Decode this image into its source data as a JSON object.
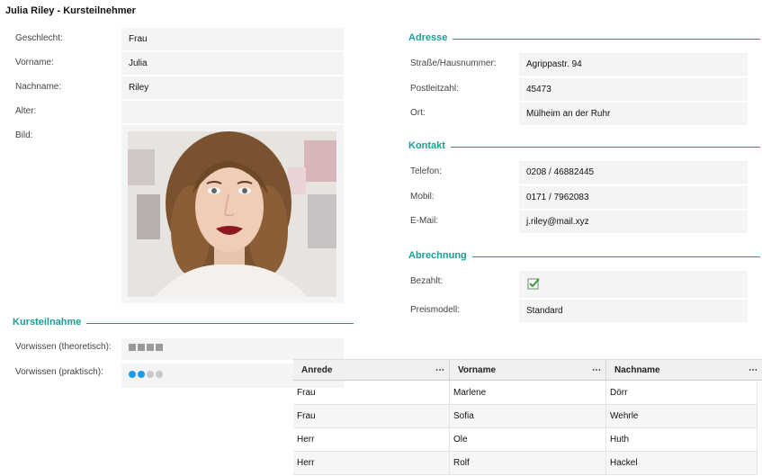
{
  "title": "Julia Riley - Kursteilnehmer",
  "personal": {
    "gender_label": "Geschlecht:",
    "gender_value": "Frau",
    "firstname_label": "Vorname:",
    "firstname_value": "Julia",
    "lastname_label": "Nachname:",
    "lastname_value": "Riley",
    "age_label": "Alter:",
    "age_value": "",
    "picture_label": "Bild:"
  },
  "address": {
    "title": "Adresse",
    "street_label": "Straße/Hausnummer:",
    "street_value": "Agrippastr. 94",
    "zip_label": "Postleitzahl:",
    "zip_value": "45473",
    "city_label": "Ort:",
    "city_value": "Mülheim an der Ruhr"
  },
  "contact": {
    "title": "Kontakt",
    "phone_label": "Telefon:",
    "phone_value": "0208 / 46882445",
    "mobile_label": "Mobil:",
    "mobile_value": "0171 / 7962083",
    "email_label": "E-Mail:",
    "email_value": "j.riley@mail.xyz"
  },
  "billing": {
    "title": "Abrechnung",
    "paid_label": "Bezahlt:",
    "paid": true,
    "model_label": "Preismodell:",
    "model_value": "Standard"
  },
  "participation": {
    "title": "Kursteilnahme",
    "theory_label": "Vorwissen (theoretisch):",
    "theory_level": 4,
    "theory_max": 4,
    "practice_label": "Vorwissen (praktisch):",
    "practice_level": 2,
    "practice_max": 4
  },
  "grid": {
    "columns": [
      "Anrede",
      "Vorname",
      "Nachname"
    ],
    "more_icon": "⋯",
    "rows": [
      [
        "Frau",
        "Marlene",
        "Dörr"
      ],
      [
        "Frau",
        "Sofia",
        "Wehrle"
      ],
      [
        "Herr",
        "Ole",
        "Huth"
      ],
      [
        "Herr",
        "Rolf",
        "Hackel"
      ]
    ]
  },
  "colors": {
    "accent": "#1a9e93",
    "dot_active": "#1e9be8",
    "dot_inactive": "#c8c8c8",
    "square": "#9a9a9a"
  }
}
